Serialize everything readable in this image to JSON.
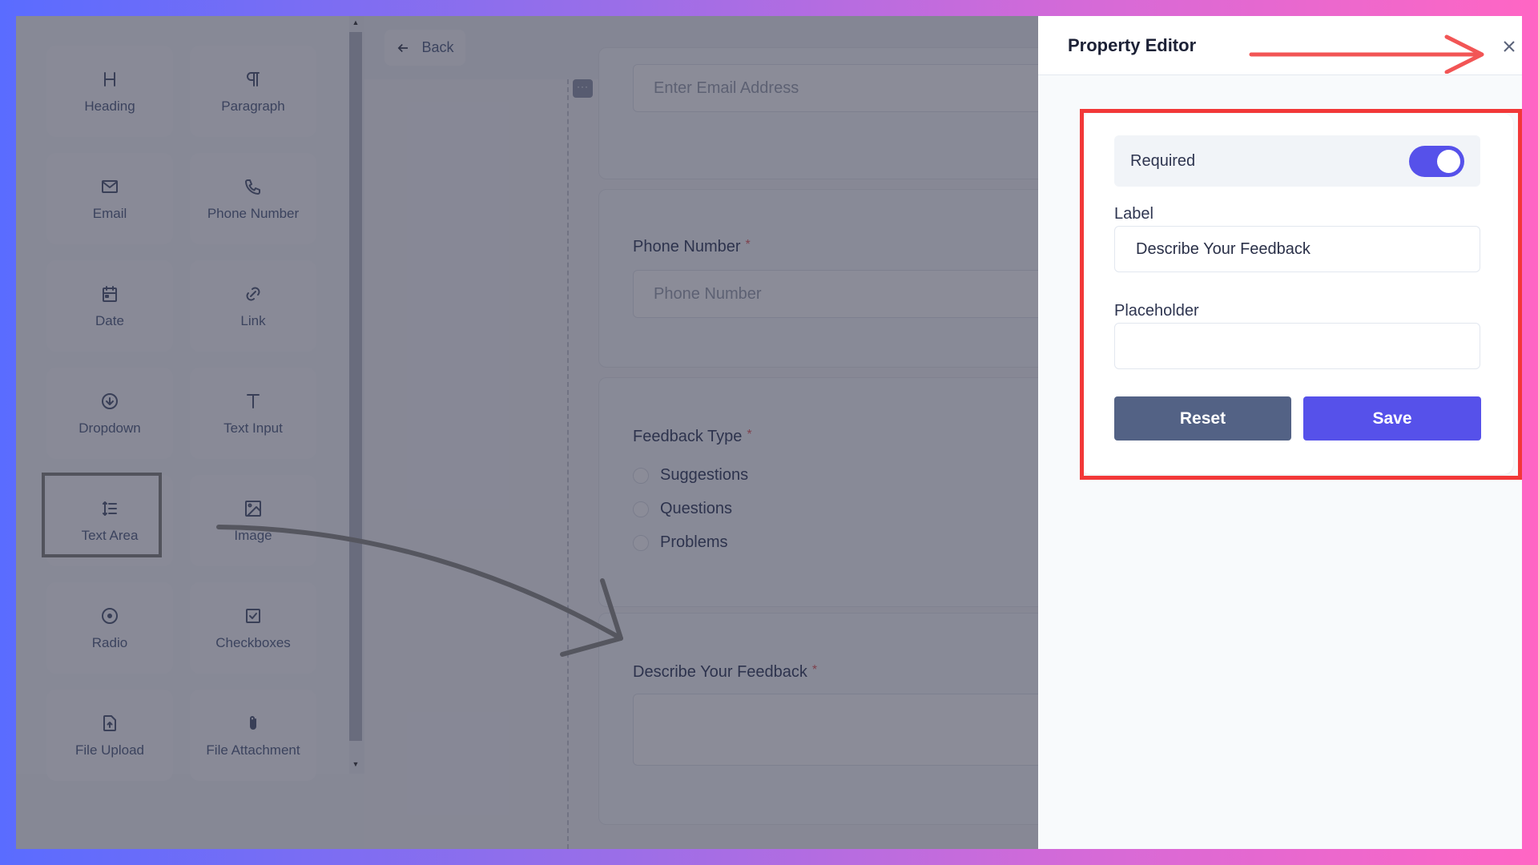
{
  "sidebar": {
    "items": [
      {
        "label": "Heading",
        "icon": "heading-icon"
      },
      {
        "label": "Paragraph",
        "icon": "paragraph-icon"
      },
      {
        "label": "Email",
        "icon": "mail-icon"
      },
      {
        "label": "Phone Number",
        "icon": "phone-icon"
      },
      {
        "label": "Date",
        "icon": "calendar-icon"
      },
      {
        "label": "Link",
        "icon": "link-icon"
      },
      {
        "label": "Dropdown",
        "icon": "arrow-down-circle-icon"
      },
      {
        "label": "Text Input",
        "icon": "text-icon"
      },
      {
        "label": "Text Area",
        "icon": "text-area-icon"
      },
      {
        "label": "Image",
        "icon": "image-icon"
      },
      {
        "label": "Radio",
        "icon": "radio-icon"
      },
      {
        "label": "Checkboxes",
        "icon": "checkbox-icon"
      },
      {
        "label": "File Upload",
        "icon": "file-upload-icon"
      },
      {
        "label": "File Attachment",
        "icon": "paperclip-icon"
      }
    ]
  },
  "toolbar": {
    "back_label": "Back"
  },
  "form": {
    "email_placeholder": "Enter Email Address",
    "phone": {
      "label": "Phone Number",
      "required_mark": "*",
      "placeholder": "Phone Number"
    },
    "feedback_type": {
      "label": "Feedback Type",
      "required_mark": "*",
      "options": [
        "Suggestions",
        "Questions",
        "Problems"
      ]
    },
    "describe": {
      "label": "Describe Your Feedback",
      "required_mark": "*"
    },
    "handle_label": "···"
  },
  "property_editor": {
    "title": "Property Editor",
    "required_label": "Required",
    "required_on": true,
    "label_caption": "Label",
    "label_value": "Describe Your Feedback",
    "placeholder_caption": "Placeholder",
    "placeholder_value": "",
    "reset_label": "Reset",
    "save_label": "Save"
  },
  "colors": {
    "accent": "#5651ea",
    "reset": "#536285",
    "annotation_red": "#f23838"
  }
}
